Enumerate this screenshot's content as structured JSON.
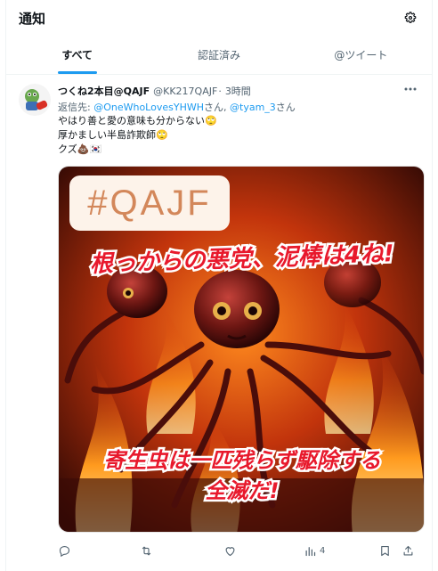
{
  "header": {
    "title": "通知",
    "settings_icon": "gear-icon"
  },
  "tabs": [
    {
      "label": "すべて",
      "active": true
    },
    {
      "label": "認証済み",
      "active": false
    },
    {
      "label": "@ツイート",
      "active": false
    }
  ],
  "tweet": {
    "author": "つくね2本目@QAJF",
    "handle": "@KK217QAJF",
    "separator": "·",
    "time": "3時間",
    "reply_prefix": "返信先: ",
    "reply_user1": "@OneWhoLovesYHWH",
    "reply_sep1": "さん, ",
    "reply_user2": "@tyam_3",
    "reply_sep2": "さん",
    "lines": [
      "やはり善と愛の意味も分からない🙄",
      "厚かましい半島詐欺師🙄",
      "クズ💩🇰🇷"
    ],
    "image": {
      "tag_text": "#QAJF",
      "caption_top": "根っからの悪党、泥棒は4ね!",
      "caption_bottom_1": "寄生虫は一匹残らず駆除する",
      "caption_bottom_2": "全滅だ!"
    },
    "actions": {
      "reply_count": "",
      "retweet_count": "",
      "like_count": "",
      "views_count": "4"
    }
  },
  "colors": {
    "accent": "#1d9bf0",
    "secondary_text": "#536471",
    "divider": "#eff3f4"
  }
}
